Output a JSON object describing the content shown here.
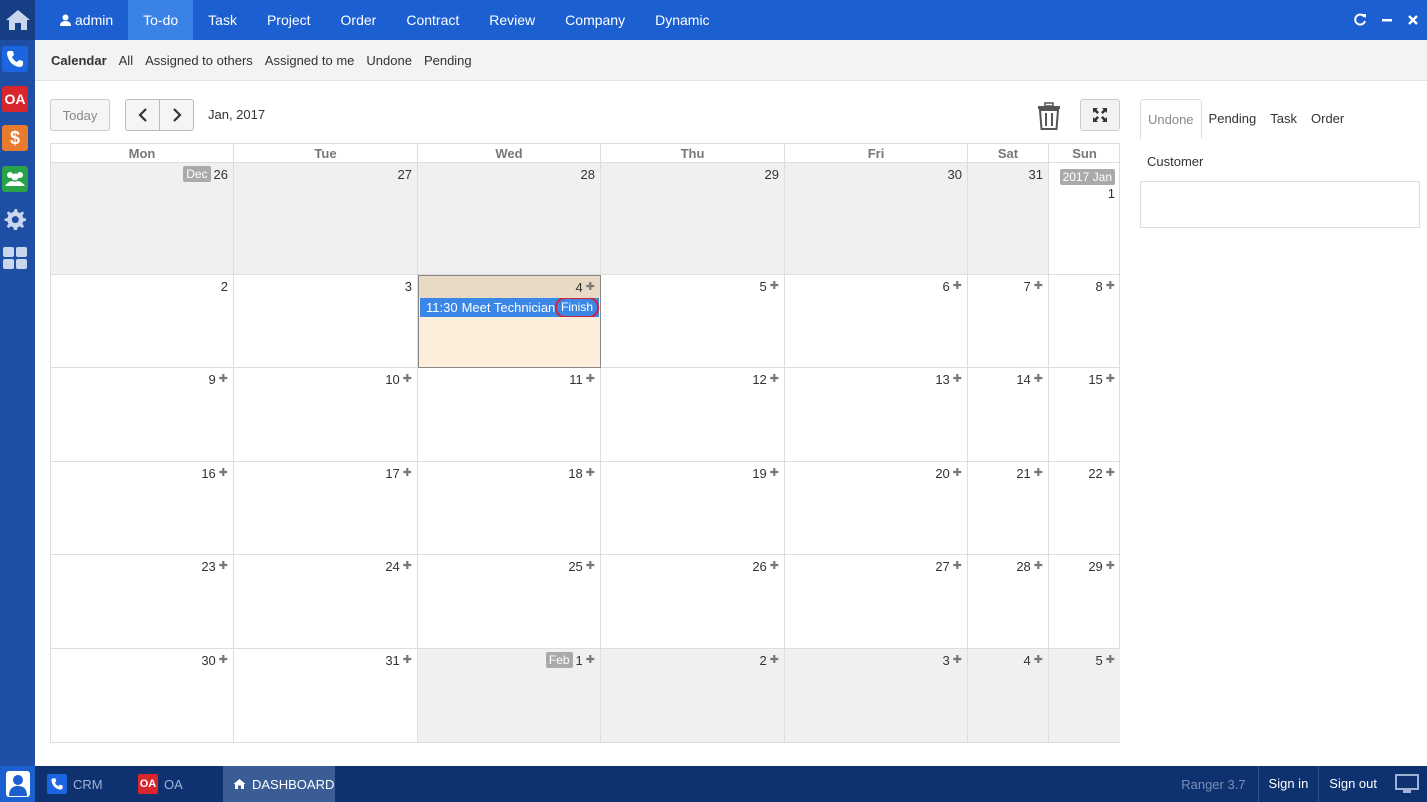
{
  "topnav": {
    "user": "admin",
    "items": [
      "To-do",
      "Task",
      "Project",
      "Order",
      "Contract",
      "Review",
      "Company",
      "Dynamic"
    ],
    "active": "To-do"
  },
  "subnav": {
    "items": [
      "Calendar",
      "All",
      "Assigned to others",
      "Assigned to me",
      "Undone",
      "Pending"
    ],
    "active": "Calendar"
  },
  "sidebar": {
    "oa_label": "OA",
    "dollar_label": "$"
  },
  "toolbar": {
    "today_label": "Today",
    "month_title": "Jan, 2017"
  },
  "calendar": {
    "weekdays": [
      "Mon",
      "Tue",
      "Wed",
      "Thu",
      "Fri",
      "Sat",
      "Sun"
    ],
    "weeks": [
      [
        {
          "day": "26",
          "label": "Dec",
          "other": true
        },
        {
          "day": "27",
          "other": true
        },
        {
          "day": "28",
          "other": true
        },
        {
          "day": "29",
          "other": true
        },
        {
          "day": "30",
          "other": true
        },
        {
          "day": "31",
          "other": true
        },
        {
          "day": "1",
          "label": "2017 Jan"
        }
      ],
      [
        {
          "day": "2"
        },
        {
          "day": "3"
        },
        {
          "day": "4",
          "plus": true,
          "today": true
        },
        {
          "day": "5",
          "plus": true
        },
        {
          "day": "6",
          "plus": true
        },
        {
          "day": "7",
          "plus": true
        },
        {
          "day": "8",
          "plus": true
        }
      ],
      [
        {
          "day": "9",
          "plus": true
        },
        {
          "day": "10",
          "plus": true
        },
        {
          "day": "11",
          "plus": true
        },
        {
          "day": "12",
          "plus": true
        },
        {
          "day": "13",
          "plus": true
        },
        {
          "day": "14",
          "plus": true
        },
        {
          "day": "15",
          "plus": true
        }
      ],
      [
        {
          "day": "16",
          "plus": true
        },
        {
          "day": "17",
          "plus": true
        },
        {
          "day": "18",
          "plus": true
        },
        {
          "day": "19",
          "plus": true
        },
        {
          "day": "20",
          "plus": true
        },
        {
          "day": "21",
          "plus": true
        },
        {
          "day": "22",
          "plus": true
        }
      ],
      [
        {
          "day": "23",
          "plus": true
        },
        {
          "day": "24",
          "plus": true
        },
        {
          "day": "25",
          "plus": true
        },
        {
          "day": "26",
          "plus": true
        },
        {
          "day": "27",
          "plus": true
        },
        {
          "day": "28",
          "plus": true
        },
        {
          "day": "29",
          "plus": true
        }
      ],
      [
        {
          "day": "30",
          "plus": true
        },
        {
          "day": "31",
          "plus": true
        },
        {
          "day": "1",
          "label": "Feb",
          "plus": true,
          "other": true
        },
        {
          "day": "2",
          "plus": true,
          "other": true
        },
        {
          "day": "3",
          "plus": true,
          "other": true
        },
        {
          "day": "4",
          "plus": true,
          "other": true
        },
        {
          "day": "5",
          "plus": true,
          "other": true
        }
      ]
    ],
    "event": {
      "time": "11:30",
      "title": "Meet Technician",
      "action": "Finish",
      "week": 1,
      "weekday": 2
    }
  },
  "rightpanel": {
    "tabs": [
      "Undone",
      "Pending",
      "Task",
      "Order"
    ],
    "active": "Undone",
    "customer_label": "Customer"
  },
  "bottombar": {
    "tabs": [
      {
        "icon": "phone",
        "label": "CRM"
      },
      {
        "icon": "OA",
        "label": "OA"
      },
      {
        "icon": "home",
        "label": "DASHBOARD",
        "active": true
      }
    ],
    "version": "Ranger 3.7",
    "sign_in": "Sign in",
    "sign_out": "Sign out"
  },
  "colors": {
    "topbar": "#1b5fd0",
    "sidebar": "#1f4fa5",
    "event": "#3a87e8",
    "today_cell": "#fdeedb",
    "finish_ring": "#d0243c"
  }
}
